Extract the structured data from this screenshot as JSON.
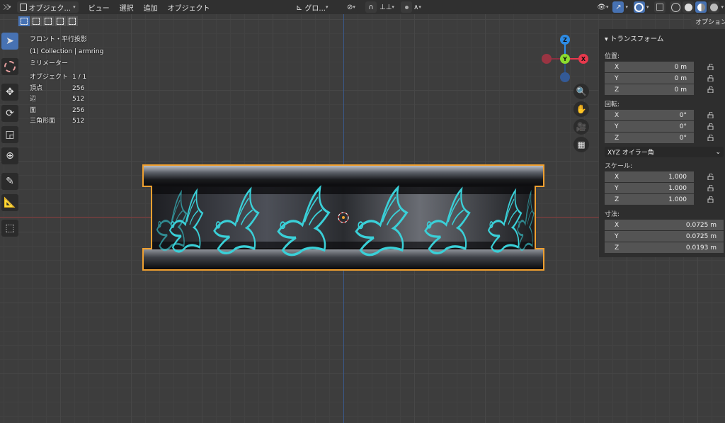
{
  "header": {
    "mode_label": "オブジェク...",
    "menus": [
      "ビュー",
      "選択",
      "追加",
      "オブジェクト"
    ],
    "transform_orientation": "グロ..."
  },
  "overlay": {
    "view_name": "フロント・平行投影",
    "collection": "(1) Collection | armring",
    "units": "ミリメーター"
  },
  "stats": [
    {
      "label": "オブジェクト",
      "value": "1 / 1"
    },
    {
      "label": "頂点",
      "value": "256"
    },
    {
      "label": "辺",
      "value": "512"
    },
    {
      "label": "面",
      "value": "256"
    },
    {
      "label": "三角形面",
      "value": "512"
    }
  ],
  "gizmo": {
    "x": "X",
    "y": "Y",
    "z": "Z"
  },
  "panel": {
    "title": "トランスフォーム",
    "options_tab": "オプション",
    "location_label": "位置:",
    "location": [
      {
        "axis": "X",
        "value": "0 m"
      },
      {
        "axis": "Y",
        "value": "0 m"
      },
      {
        "axis": "Z",
        "value": "0 m"
      }
    ],
    "rotation_label": "回転:",
    "rotation": [
      {
        "axis": "X",
        "value": "0°"
      },
      {
        "axis": "Y",
        "value": "0°"
      },
      {
        "axis": "Z",
        "value": "0°"
      }
    ],
    "rotation_mode": "XYZ オイラー角",
    "scale_label": "スケール:",
    "scale": [
      {
        "axis": "X",
        "value": "1.000"
      },
      {
        "axis": "Y",
        "value": "1.000"
      },
      {
        "axis": "Z",
        "value": "1.000"
      }
    ],
    "dimensions_label": "寸法:",
    "dimensions": [
      {
        "axis": "X",
        "value": "0.0725 m"
      },
      {
        "axis": "Y",
        "value": "0.0725 m"
      },
      {
        "axis": "Z",
        "value": "0.0193 m"
      }
    ]
  },
  "colors": {
    "accent_blue": "#4772b3",
    "selection_orange": "#f0a030",
    "engraving_cyan": "#3ad0d8",
    "x_axis": "#e8394d",
    "y_axis": "#8bdc2e",
    "z_axis": "#2d8ce6"
  }
}
